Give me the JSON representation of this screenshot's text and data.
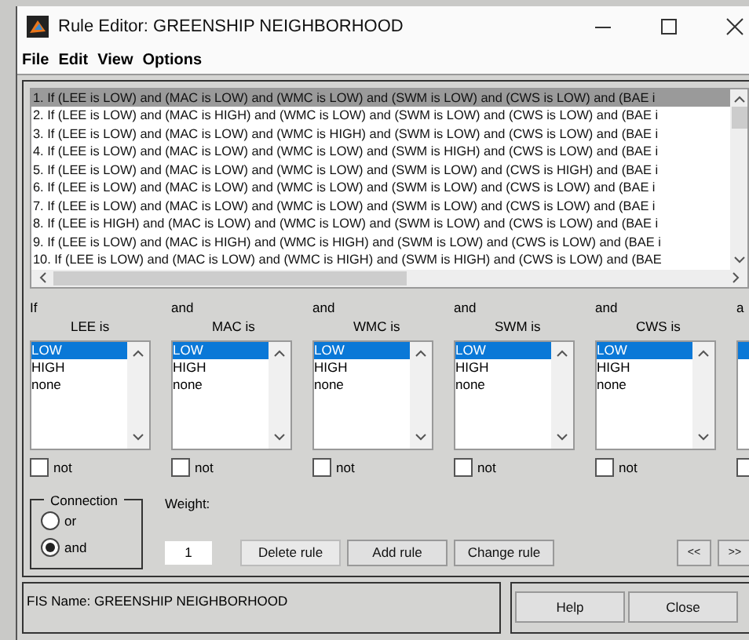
{
  "window": {
    "title": "Rule Editor: GREENSHIP NEIGHBORHOOD"
  },
  "menu": [
    "File",
    "Edit",
    "View",
    "Options"
  ],
  "rules": [
    {
      "text": "1. If (LEE is LOW) and (MAC is LOW) and (WMC is LOW) and (SWM is LOW) and (CWS is LOW) and (BAE i",
      "selected": true
    },
    {
      "text": "2. If (LEE is LOW) and (MAC is HIGH) and (WMC is LOW) and (SWM is LOW) and (CWS is LOW) and (BAE i",
      "selected": false
    },
    {
      "text": "3. If (LEE is LOW) and (MAC is LOW) and (WMC is HIGH) and (SWM is LOW) and (CWS is LOW) and (BAE i",
      "selected": false
    },
    {
      "text": "4. If (LEE is LOW) and (MAC is LOW) and (WMC is LOW) and (SWM is HIGH) and (CWS is LOW) and (BAE i",
      "selected": false
    },
    {
      "text": "5. If (LEE is LOW) and (MAC is LOW) and (WMC is LOW) and (SWM is LOW) and (CWS is HIGH) and (BAE i",
      "selected": false
    },
    {
      "text": "6. If (LEE is LOW) and (MAC is LOW) and (WMC is LOW) and (SWM is LOW) and (CWS is LOW) and (BAE i",
      "selected": false
    },
    {
      "text": "7. If (LEE is LOW) and (MAC is LOW) and (WMC is LOW) and (SWM is LOW) and (CWS is LOW) and (BAE i",
      "selected": false
    },
    {
      "text": "8. If (LEE is HIGH) and (MAC is LOW) and (WMC is LOW) and (SWM is LOW) and (CWS is LOW) and (BAE i",
      "selected": false
    },
    {
      "text": "9. If (LEE is LOW) and (MAC is HIGH) and (WMC is HIGH) and (SWM is LOW) and (CWS is LOW) and (BAE i",
      "selected": false
    },
    {
      "text": "10. If (LEE is LOW) and (MAC is LOW) and (WMC is HIGH) and (SWM is HIGH) and (CWS is LOW) and (BAE",
      "selected": false
    }
  ],
  "columns": [
    {
      "connective": "If",
      "variable": "LEE is",
      "options": [
        {
          "label": "LOW",
          "selected": true
        },
        {
          "label": "HIGH",
          "selected": false
        },
        {
          "label": "none",
          "selected": false
        }
      ],
      "not_label": "not",
      "not_checked": false
    },
    {
      "connective": "and",
      "variable": "MAC is",
      "options": [
        {
          "label": "LOW",
          "selected": true
        },
        {
          "label": "HIGH",
          "selected": false
        },
        {
          "label": "none",
          "selected": false
        }
      ],
      "not_label": "not",
      "not_checked": false
    },
    {
      "connective": "and",
      "variable": "WMC is",
      "options": [
        {
          "label": "LOW",
          "selected": true
        },
        {
          "label": "HIGH",
          "selected": false
        },
        {
          "label": "none",
          "selected": false
        }
      ],
      "not_label": "not",
      "not_checked": false
    },
    {
      "connective": "and",
      "variable": "SWM is",
      "options": [
        {
          "label": "LOW",
          "selected": true
        },
        {
          "label": "HIGH",
          "selected": false
        },
        {
          "label": "none",
          "selected": false
        }
      ],
      "not_label": "not",
      "not_checked": false
    },
    {
      "connective": "and",
      "variable": "CWS is",
      "options": [
        {
          "label": "LOW",
          "selected": true
        },
        {
          "label": "HIGH",
          "selected": false
        },
        {
          "label": "none",
          "selected": false
        }
      ],
      "not_label": "not",
      "not_checked": false
    }
  ],
  "partial_column": {
    "connective": "a",
    "not_checked": false
  },
  "connection": {
    "title": "Connection",
    "options": [
      {
        "label": "or",
        "selected": false
      },
      {
        "label": "and",
        "selected": true
      }
    ]
  },
  "weight": {
    "label": "Weight:",
    "value": "1"
  },
  "buttons": [
    "Delete rule",
    "Add rule",
    "Change rule"
  ],
  "nav_buttons": [
    "<<",
    ">>"
  ],
  "status": "FIS Name: GREENSHIP NEIGHBORHOOD",
  "footer_buttons": [
    "Help",
    "Close"
  ]
}
